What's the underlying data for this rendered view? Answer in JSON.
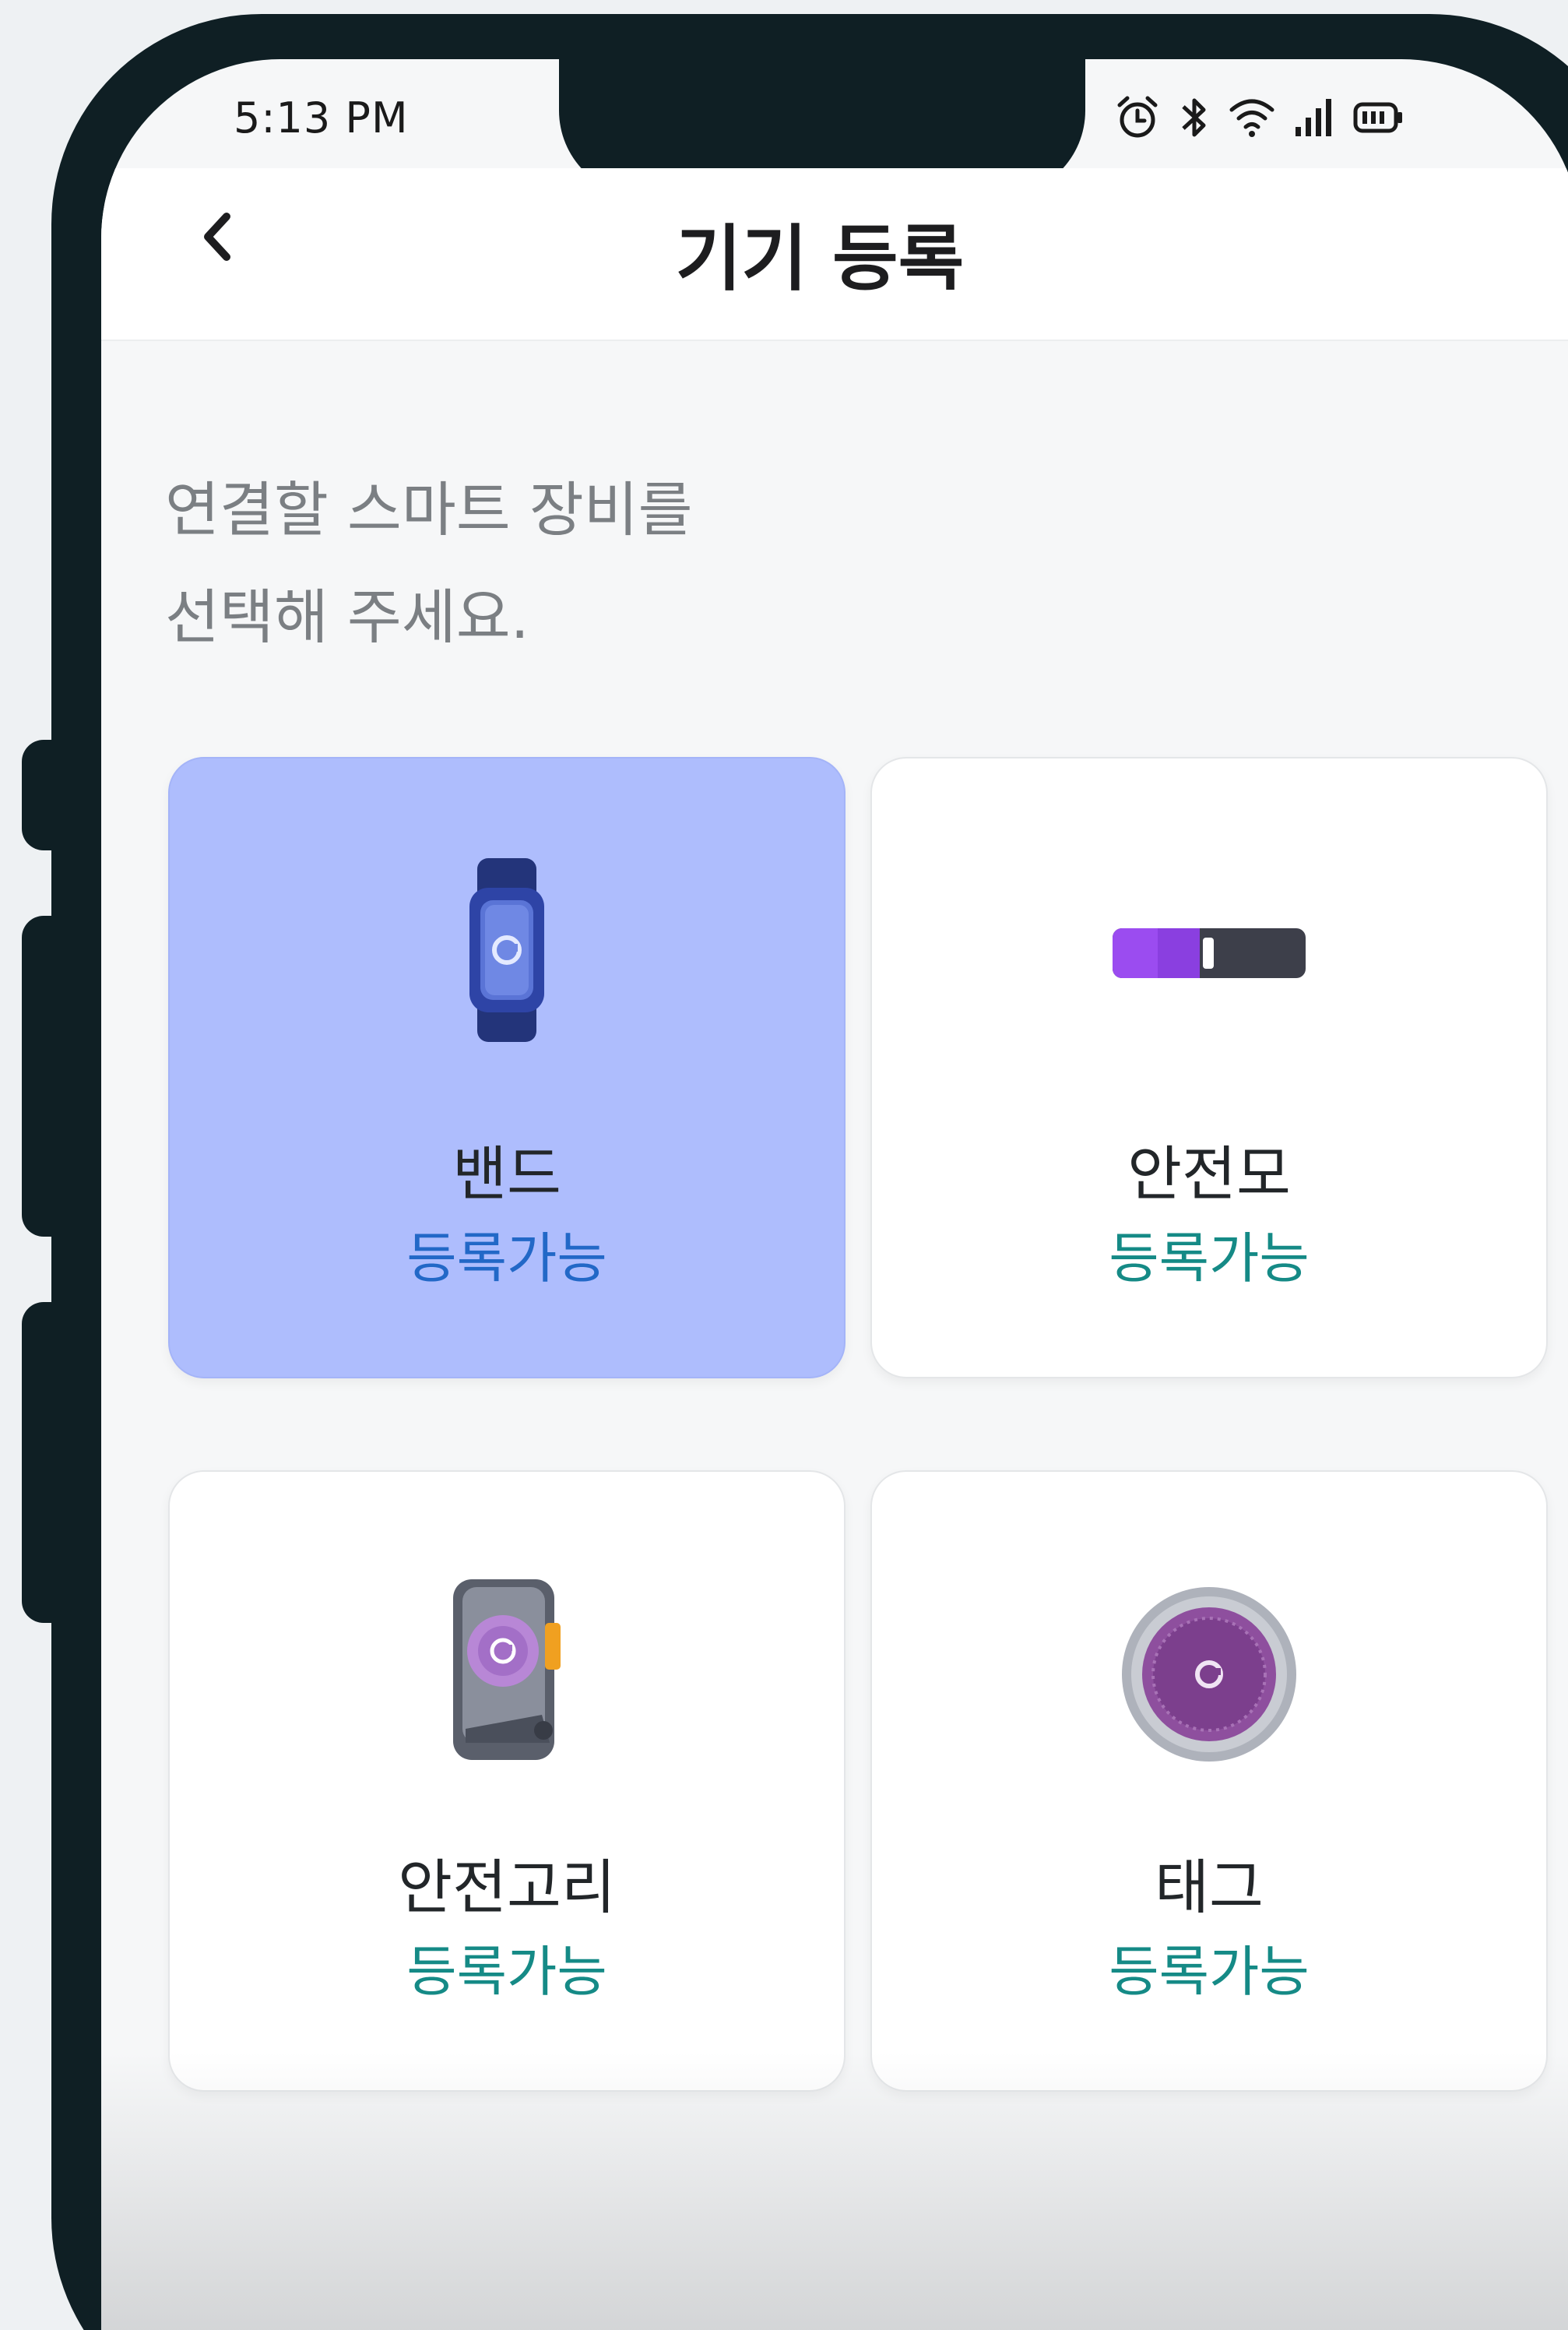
{
  "status_bar": {
    "time": "5:13 PM",
    "icons": [
      "alarm-icon",
      "bluetooth-icon",
      "wifi-icon",
      "signal-icon",
      "battery-icon"
    ]
  },
  "header": {
    "back_icon": "chevron-left-icon",
    "title": "기기 등록"
  },
  "prompt": {
    "line1": "연결할 스마트 장비를",
    "line2": "선택해 주세요."
  },
  "devices": [
    {
      "name": "밴드",
      "status": "등록가능",
      "icon": "band-icon",
      "selected": true
    },
    {
      "name": "안전모",
      "status": "등록가능",
      "icon": "helmet-sensor-icon",
      "selected": false
    },
    {
      "name": "안전고리",
      "status": "등록가능",
      "icon": "safety-hook-icon",
      "selected": false
    },
    {
      "name": "태그",
      "status": "등록가능",
      "icon": "tag-icon",
      "selected": false
    }
  ],
  "colors": {
    "selected_card": "#aebdfd",
    "status_available": "#158a86",
    "status_selected": "#2268c7",
    "frame": "#0f1f24"
  }
}
